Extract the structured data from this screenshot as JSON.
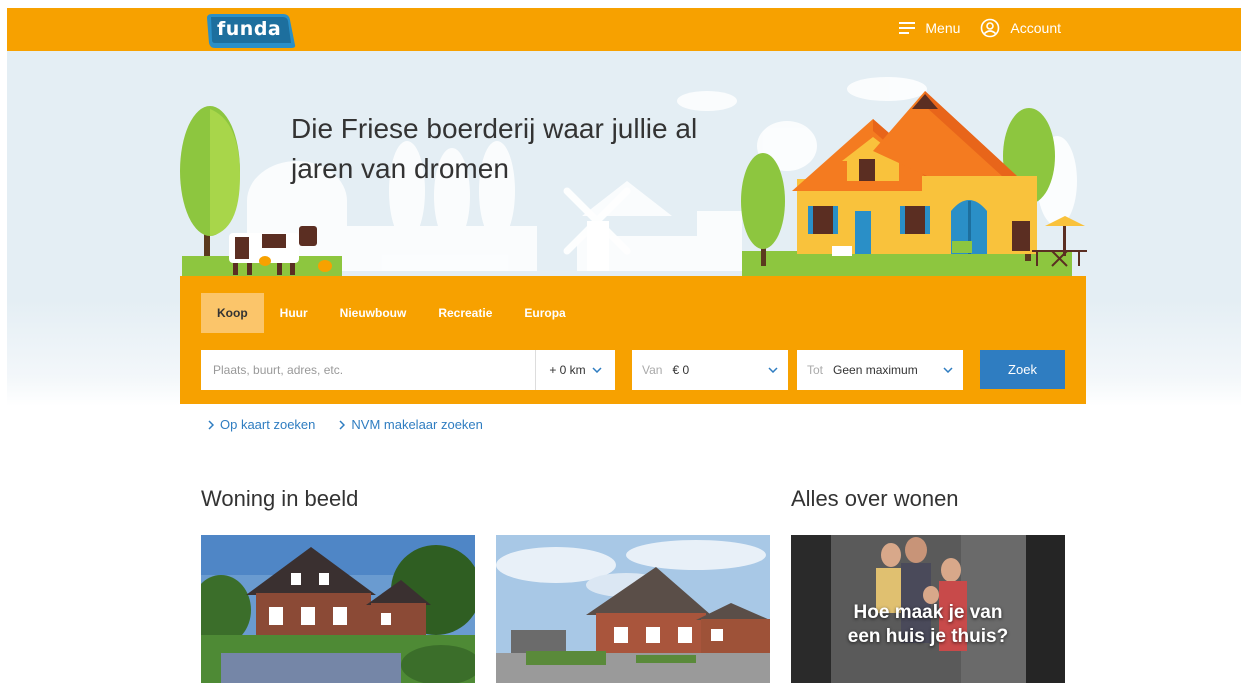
{
  "header": {
    "logo_text": "funda",
    "menu_label": "Menu",
    "account_label": "Account"
  },
  "hero": {
    "title": "Die Friese boerderij waar jullie al jaren van dromen"
  },
  "search": {
    "tabs": [
      {
        "label": "Koop",
        "active": true
      },
      {
        "label": "Huur",
        "active": false
      },
      {
        "label": "Nieuwbouw",
        "active": false
      },
      {
        "label": "Recreatie",
        "active": false
      },
      {
        "label": "Europa",
        "active": false
      }
    ],
    "place_placeholder": "Plaats, buurt, adres, etc.",
    "radius_value": "+ 0 km",
    "price_from_label": "Van",
    "price_from_value": "€ 0",
    "price_to_label": "Tot",
    "price_to_value": "Geen maximum",
    "submit_label": "Zoek"
  },
  "quick_links": [
    {
      "label": "Op kaart zoeken"
    },
    {
      "label": "NVM makelaar zoeken"
    }
  ],
  "sections": {
    "woning_title": "Woning in beeld",
    "wonen_title": "Alles over wonen",
    "wonen_caption_line1": "Hoe maak je van",
    "wonen_caption_line2": "een huis je thuis?"
  },
  "colors": {
    "brand_orange": "#f7a100",
    "active_tab": "#fbc56a",
    "button_blue": "#2f7dc1",
    "logo_blue": "#2a8fc7"
  }
}
